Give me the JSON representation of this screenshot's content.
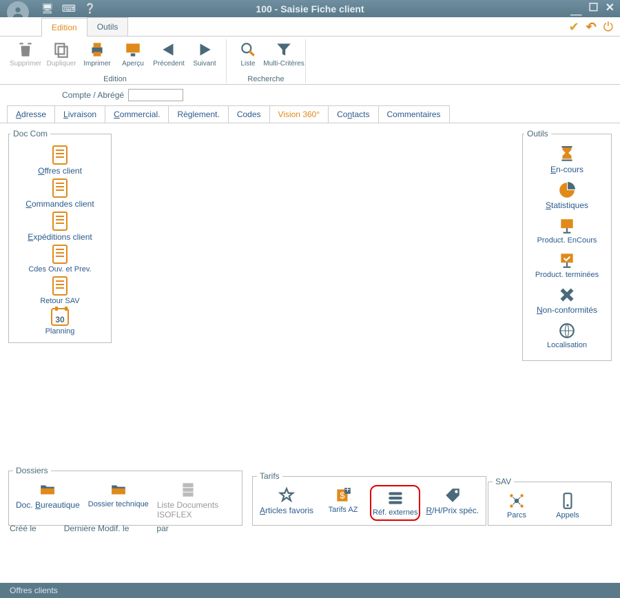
{
  "window": {
    "title": "100 - Saisie Fiche client"
  },
  "tabs": {
    "edition": "Edition",
    "outils": "Outils"
  },
  "toolbar": {
    "supprimer": "Supprimer",
    "dupliquer": "Dupliquer",
    "imprimer": "Imprimer",
    "apercu": "Aperçu",
    "precedent": "Précedent",
    "suivant": "Suivant",
    "liste": "Liste",
    "multi": "Multi-Critères",
    "grp_edition": "Edition",
    "grp_recherche": "Recherche"
  },
  "form": {
    "compte_label": "Compte / Abrégé",
    "compte_value": ""
  },
  "subtabs": {
    "adresse": "dresse",
    "adresse_u": "A",
    "livraison": "ivraison",
    "livraison_u": "L",
    "commercial": "ommercial.",
    "commercial_u": "C",
    "reglement": "Règlement.",
    "codes": "Codes",
    "vision": "Vision 360°",
    "contacts": "ntacts",
    "contacts_u": "Co",
    "commentaires": "Commentaires"
  },
  "doccom": {
    "legend": "Doc Com",
    "offres": "ffres client",
    "offres_u": "O",
    "commandes": "ommandes client",
    "commandes_u": "C",
    "expeditions": "xpéditions client",
    "expeditions_u": "E",
    "cdes": "Cdes Ouv. et Prev.",
    "retour": "Retour SAV",
    "planning": "Planning",
    "planning_day": "30"
  },
  "outils": {
    "legend": "Outils",
    "encours": "n-cours",
    "encours_u": "E",
    "stats": "tatistiques",
    "stats_u": "S",
    "prod_enc": "Product. EnCours",
    "prod_term": "Product. terminées",
    "nonconf": "on-conformités",
    "nonconf_u": "N",
    "localisation": "Localisation"
  },
  "dossiers": {
    "legend": "Dossiers",
    "bureautique": "ureautique",
    "bureautique_pre": "Doc. ",
    "bureautique_u": "B",
    "technique": "Dossier technique",
    "liste_docs": "Liste Documents",
    "isoflex": "ISOFLEX"
  },
  "tarifs": {
    "legend": "Tarifs",
    "favoris": "rticles favoris",
    "favoris_u": "A",
    "tarifs_az": "Tarifs AZ",
    "ref_ext": "Réf. externes",
    "rh": "/H/Prix spéc.",
    "rh_u": "R"
  },
  "sav": {
    "legend": "SAV",
    "parcs": "Parcs",
    "appels": "Appels"
  },
  "footer": {
    "cree": "Créé le",
    "modif": "Dernière Modif. le",
    "par": "par"
  },
  "status": "Offres clients"
}
